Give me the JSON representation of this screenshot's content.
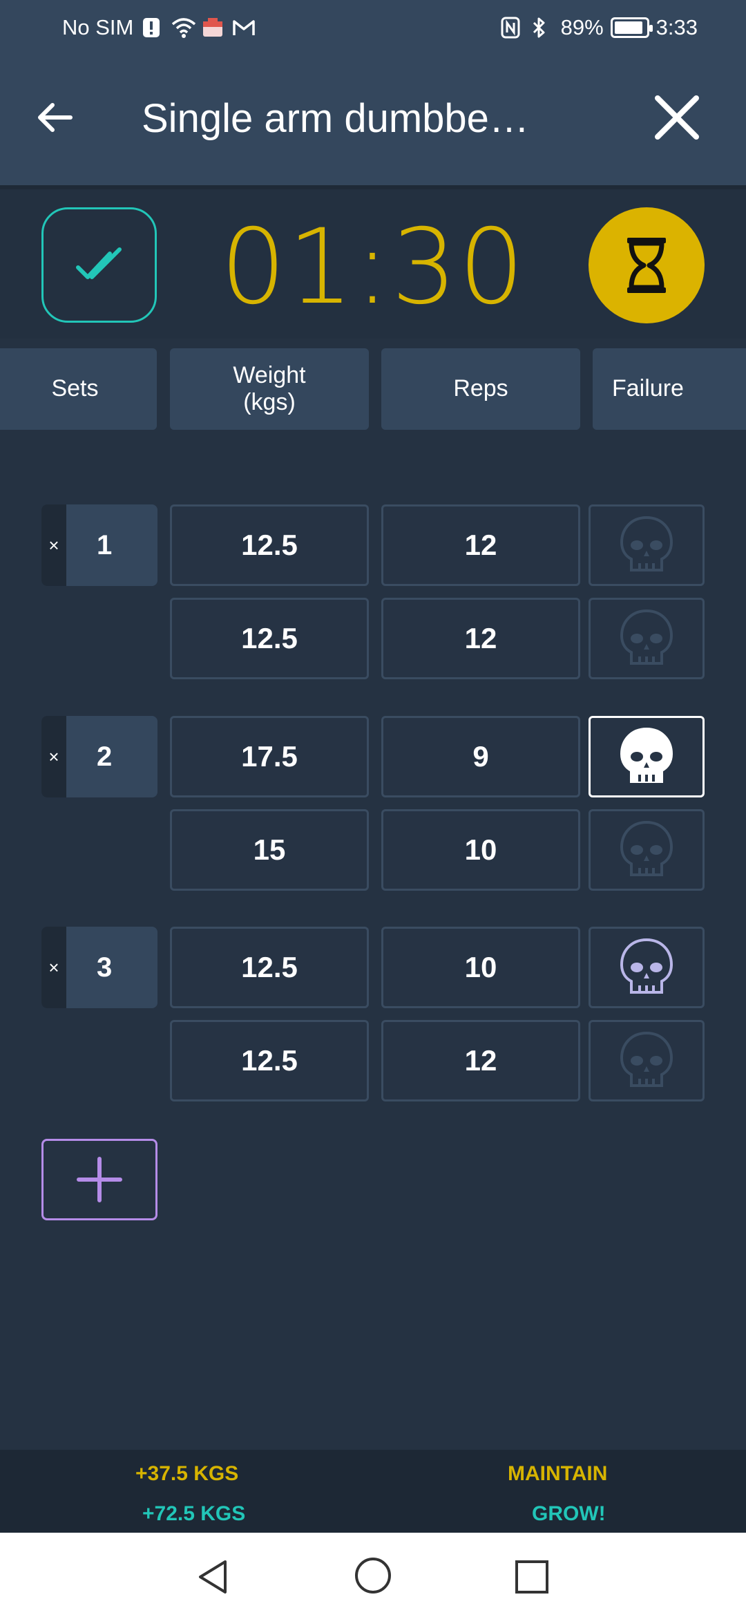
{
  "status_bar": {
    "carrier": "No SIM",
    "battery": "89%",
    "time": "3:33"
  },
  "header": {
    "title": "Single arm dumbbe…"
  },
  "timer": {
    "display": "01:30",
    "accent": "#d7b400"
  },
  "columns": [
    "Sets",
    "Weight\n(kgs)",
    "Reps",
    "Failure"
  ],
  "columns_text": {
    "sets": "Sets",
    "weight_line1": "Weight",
    "weight_line2": "(kgs)",
    "reps": "Reps",
    "failure": "Failure"
  },
  "sets": [
    {
      "number": "1",
      "remove_label": "×",
      "rows": [
        {
          "weight": "12.5",
          "reps": "12",
          "failure": "off"
        },
        {
          "weight": "12.5",
          "reps": "12",
          "failure": "off"
        }
      ]
    },
    {
      "number": "2",
      "remove_label": "×",
      "rows": [
        {
          "weight": "17.5",
          "reps": "9",
          "failure": "selected"
        },
        {
          "weight": "15",
          "reps": "10",
          "failure": "off"
        }
      ]
    },
    {
      "number": "3",
      "remove_label": "×",
      "rows": [
        {
          "weight": "12.5",
          "reps": "10",
          "failure": "partial"
        },
        {
          "weight": "12.5",
          "reps": "12",
          "failure": "off"
        }
      ]
    }
  ],
  "summary": {
    "left_top": "+37.5 KGS",
    "left_bottom": "+72.5 KGS",
    "right_top": "MAINTAIN",
    "right_bottom": "GROW!",
    "yellow": "#d7b400",
    "teal": "#22c6b8"
  },
  "icons": {
    "back": "arrow-left-icon",
    "close": "close-icon",
    "done": "double-check-icon",
    "rest": "hourglass-icon",
    "failure": "skull-icon",
    "add": "plus-icon"
  }
}
